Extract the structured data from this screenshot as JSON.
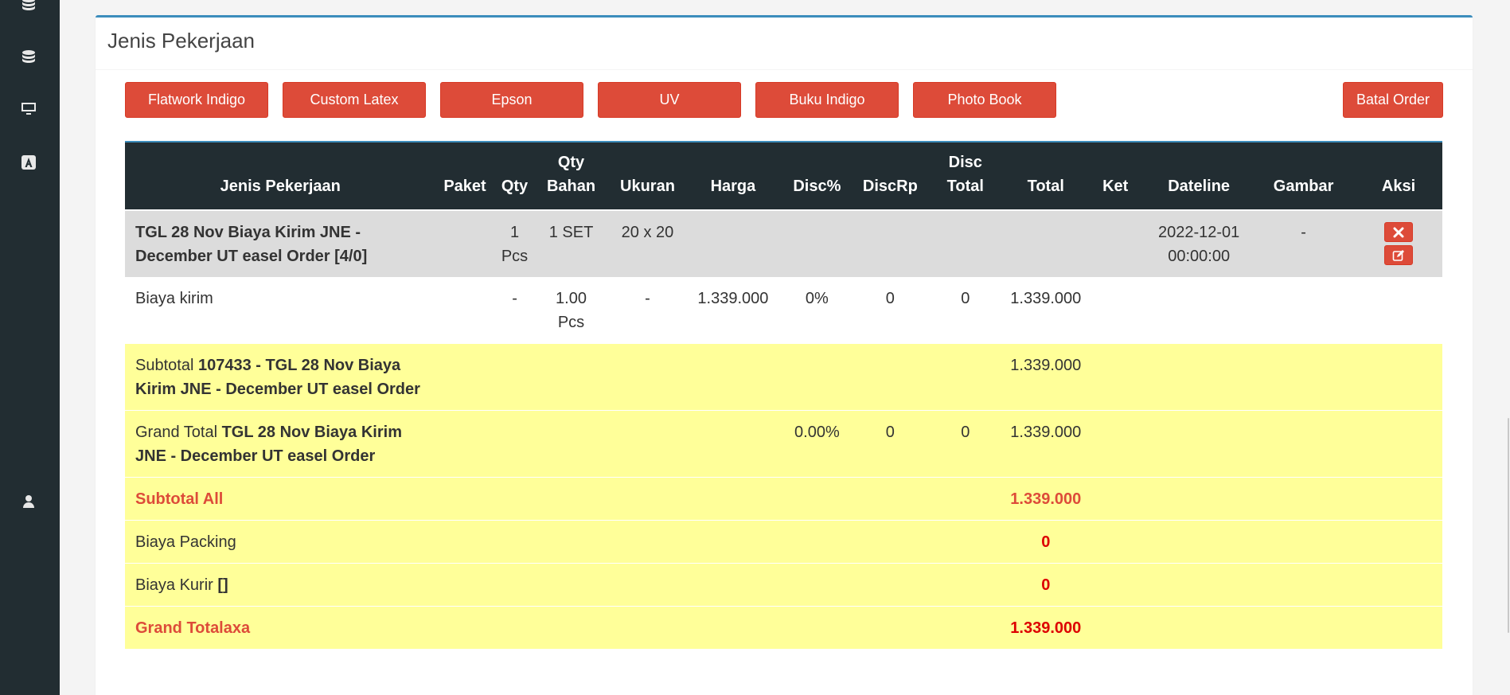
{
  "sidebar": {
    "icons": [
      "database-icon",
      "database-icon",
      "desktop-icon",
      "font-icon",
      "user-icon"
    ]
  },
  "box": {
    "title": "Jenis Pekerjaan"
  },
  "buttons": {
    "flatwork_indigo": "Flatwork Indigo",
    "custom_latex": "Custom Latex",
    "epson": "Epson",
    "uv": "UV",
    "buku_indigo": "Buku Indigo",
    "photo_book": "Photo Book",
    "batal_order": "Batal Order"
  },
  "table": {
    "headers": {
      "jenis": "Jenis Pekerjaan",
      "paket": "Paket",
      "qty": "Qty",
      "qty_bahan_1": "Qty",
      "qty_bahan_2": "Bahan",
      "ukuran": "Ukuran",
      "harga": "Harga",
      "disc_pct": "Disc%",
      "disc_rp": "DiscRp",
      "disc_total_1": "Disc",
      "disc_total_2": "Total",
      "total": "Total",
      "ket": "Ket",
      "dateline": "Dateline",
      "gambar": "Gambar",
      "aksi": "Aksi"
    },
    "group_row": {
      "title": "TGL 28 Nov Biaya Kirim JNE - December UT easel Order [4/0]",
      "qty_1": "1",
      "qty_2": "Pcs",
      "qty_bahan": "1 SET",
      "ukuran": "20 x 20",
      "dateline_1": "2022-12-01",
      "dateline_2": "00:00:00",
      "gambar": "-"
    },
    "item_row": {
      "name": "Biaya kirim",
      "qty": "-",
      "qty_bahan_1": "1.00",
      "qty_bahan_2": "Pcs",
      "ukuran": "-",
      "harga": "1.339.000",
      "disc_pct": "0%",
      "disc_rp": "0",
      "disc_total": "0",
      "total": "1.339.000"
    },
    "subtotal_row": {
      "label": "Subtotal",
      "title": "107433 - TGL 28 Nov Biaya Kirim JNE - December UT easel Order",
      "total": "1.339.000"
    },
    "grand_total_row": {
      "label": "Grand Total",
      "title": "TGL 28 Nov Biaya Kirim JNE - December UT easel Order",
      "disc_pct": "0.00%",
      "disc_rp": "0",
      "disc_total": "0",
      "total": "1.339.000"
    },
    "subtotal_all": {
      "label": "Subtotal All",
      "total": "1.339.000"
    },
    "biaya_packing": {
      "label": "Biaya Packing",
      "total": "0"
    },
    "biaya_kurir": {
      "label": "Biaya Kurir",
      "suffix": "[]",
      "total": "0"
    },
    "grand_totalaxa": {
      "label": "Grand Totalaxa",
      "total": "1.339.000"
    }
  },
  "colors": {
    "sidebar": "#222d32",
    "accent": "#3c8dbc",
    "button": "#dd4b39",
    "highlight": "#ffff99",
    "group_row": "#dcdcdc"
  }
}
